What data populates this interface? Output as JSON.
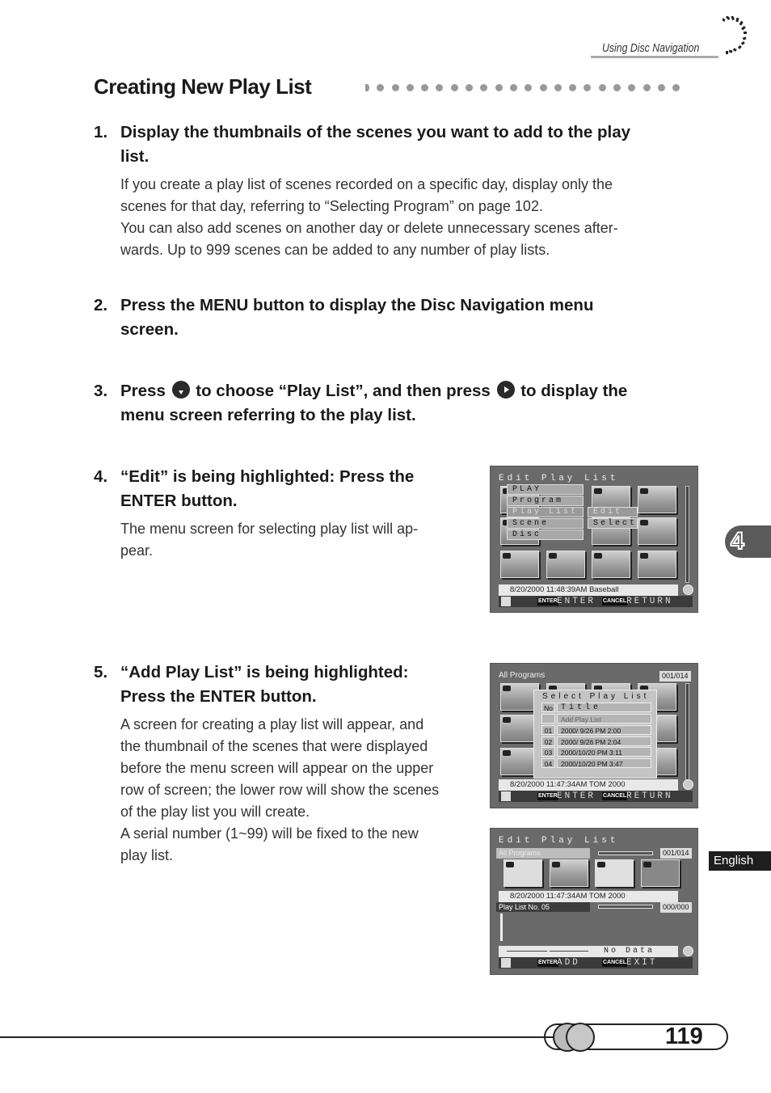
{
  "header": {
    "section": "Using Disc Navigation"
  },
  "title": "Creating New Play List",
  "steps": [
    {
      "num": "1.",
      "heading_l1": "Display the thumbnails of the scenes you want to add to the play",
      "heading_l2": "list.",
      "body": [
        "If you create a play list of scenes recorded on a specific day, display only the",
        "scenes for that day, referring to “Selecting Program” on page 102.",
        "You can also add scenes on another day or delete unnecessary scenes after-",
        "wards. Up to 999 scenes can be added to any number of play lists."
      ]
    },
    {
      "num": "2.",
      "heading_l1": "Press the MENU button to display the Disc Navigation menu",
      "heading_l2": "screen."
    },
    {
      "num": "3.",
      "heading_a": "Press",
      "heading_b": "to choose “Play List”, and then press",
      "heading_c": "to display the",
      "heading_l2": "menu screen referring to the play list.",
      "icon_down": "joystick-down-icon",
      "icon_right": "joystick-right-icon"
    },
    {
      "num": "4.",
      "heading_l1": "“Edit” is being highlighted: Press the",
      "heading_l2": "ENTER button.",
      "body": [
        "The menu screen for selecting play list will ap-",
        "pear."
      ]
    },
    {
      "num": "5.",
      "heading_l1": "“Add Play List” is being highlighted:",
      "heading_l2": "Press the ENTER button.",
      "body": [
        "A screen for creating a play list will appear, and",
        "the thumbnail of the scenes that were displayed",
        "before the menu screen will appear on the upper",
        "row of screen; the lower row will show the scenes",
        "of the play list you will create.",
        "A serial number (1~99) will be fixed to the new",
        "play list."
      ]
    }
  ],
  "screen1": {
    "title": "Edit Play List",
    "menu": [
      "PLAY",
      "Program",
      "Play List",
      "Scene",
      "Disc"
    ],
    "submenu": [
      "Edit",
      "Select"
    ],
    "status": "8/20/2000 11:48:39AM    Baseball",
    "enter_key": "ENTER",
    "enter_label": "ENTER",
    "cancel_key": "CANCEL",
    "cancel_label": "RETURN"
  },
  "screen2": {
    "title": "All Programs",
    "counter": "001/014",
    "dialog_title": "Select Play List",
    "col_no": "No",
    "col_title": "Title",
    "rows": [
      {
        "no": "",
        "title": "Add Play List"
      },
      {
        "no": "01",
        "title": "2000/ 9/26 PM 2:00"
      },
      {
        "no": "02",
        "title": "2000/ 9/26 PM 2:04"
      },
      {
        "no": "03",
        "title": "2000/10/20 PM 3:11"
      },
      {
        "no": "04",
        "title": "2000/10/20 PM 3:47"
      }
    ],
    "status": "8/20/2000 11:47:34AM    TOM 2000",
    "enter_key": "ENTER",
    "enter_label": "ENTER",
    "cancel_key": "CANCEL",
    "cancel_label": "RETURN"
  },
  "screen3": {
    "title": "Edit Play List",
    "source_label": "All Programs",
    "source_counter": "001/014",
    "status": "8/20/2000 11:47:34AM    TOM 2000",
    "list_label": "Play List No. 05",
    "list_counter": "000/000",
    "no_data": "No Data",
    "enter_key": "ENTER",
    "enter_label": "ADD",
    "cancel_key": "CANCEL",
    "cancel_label": "EXIT"
  },
  "chapter_tab": "4",
  "language_tab": "English",
  "page_number": "119"
}
